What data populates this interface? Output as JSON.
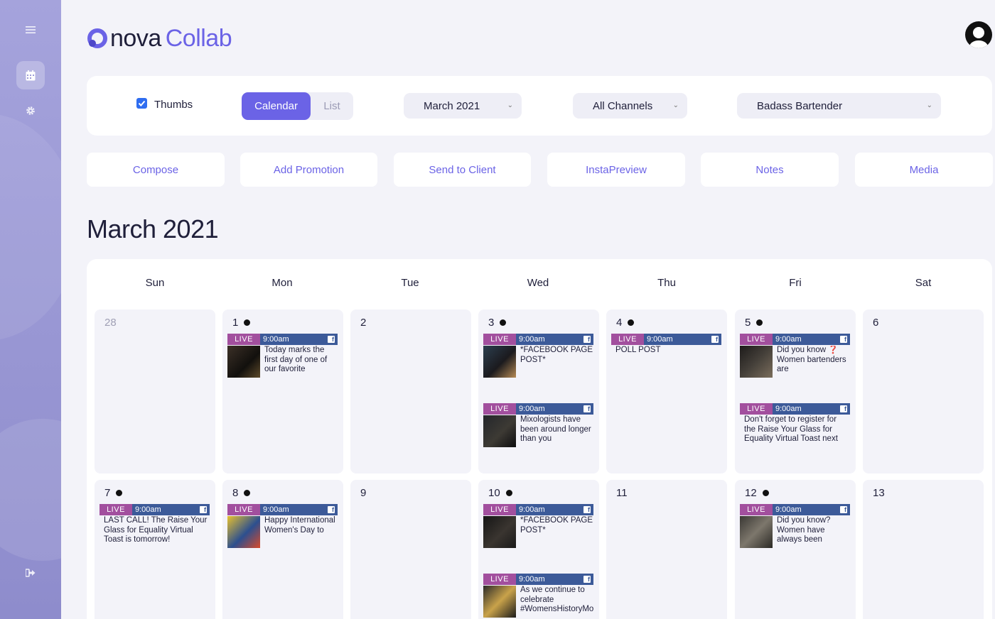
{
  "app": {
    "logo_part1": "nova",
    "logo_part2": "Collab",
    "brand_color": "#6b63e6"
  },
  "sidebar": {
    "items": [
      {
        "name": "menu",
        "icon": "hamburger-icon"
      },
      {
        "name": "calendar",
        "icon": "calendar-icon",
        "active": true
      },
      {
        "name": "settings",
        "icon": "gear-icon"
      },
      {
        "name": "logout",
        "icon": "logout-icon"
      }
    ]
  },
  "filters": {
    "thumbs_label": "Thumbs",
    "thumbs_checked": true,
    "view_calendar": "Calendar",
    "view_list": "List",
    "month": "March 2021",
    "channels": "All Channels",
    "client": "Badass Bartender"
  },
  "actions": [
    "Compose",
    "Add Promotion",
    "Send to Client",
    "InstaPreview",
    "Notes",
    "Media"
  ],
  "page_title": "March 2021",
  "calendar": {
    "weekdays": [
      "Sun",
      "Mon",
      "Tue",
      "Wed",
      "Thu",
      "Fri",
      "Sat"
    ],
    "live_label": "LIVE",
    "days": [
      {
        "num": "28",
        "muted": true
      },
      {
        "num": "1",
        "dot": true
      },
      {
        "num": "2"
      },
      {
        "num": "3",
        "dot": true
      },
      {
        "num": "4",
        "dot": true
      },
      {
        "num": "5",
        "dot": true
      },
      {
        "num": "6"
      },
      {
        "num": "7",
        "dot": true
      },
      {
        "num": "8",
        "dot": true
      },
      {
        "num": "9"
      },
      {
        "num": "10",
        "dot": true
      },
      {
        "num": "11"
      },
      {
        "num": "12",
        "dot": true
      },
      {
        "num": "13"
      }
    ],
    "posts": [
      {
        "time": "9:00am",
        "caption": "Today marks the first day of one of our favorite"
      },
      {
        "time": "9:00am",
        "caption": "*FACEBOOK PAGE POST*"
      },
      {
        "time": "9:00am",
        "caption": "Mixologists have been around longer than you"
      },
      {
        "time": "9:00am",
        "caption": "POLL POST"
      },
      {
        "time": "9:00am",
        "caption": "Did you know ❓ Women bartenders are"
      },
      {
        "time": "9:00am",
        "caption": "Don't forget to register for the Raise Your Glass for Equality Virtual Toast next"
      },
      {
        "time": "9:00am",
        "caption": "LAST CALL! The Raise Your Glass for Equality Virtual Toast is tomorrow!"
      },
      {
        "time": "9:00am",
        "caption": "Happy International Women's Day to"
      },
      {
        "time": "9:00am",
        "caption": "*FACEBOOK PAGE POST*"
      },
      {
        "time": "9:00am",
        "caption": "As we continue to celebrate #WomensHistoryMonth"
      },
      {
        "time": "9:00am",
        "caption": "Did you know? Women have always been"
      }
    ]
  }
}
